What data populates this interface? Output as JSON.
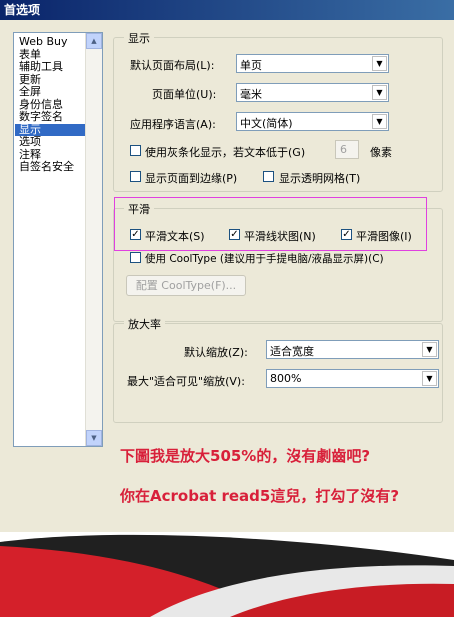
{
  "window": {
    "title": "首选项"
  },
  "sidebar": {
    "items": [
      {
        "label": "Web Buy"
      },
      {
        "label": "表单"
      },
      {
        "label": "辅助工具"
      },
      {
        "label": "更新"
      },
      {
        "label": "全屏"
      },
      {
        "label": "身份信息"
      },
      {
        "label": "数字签名"
      },
      {
        "label": "显示"
      },
      {
        "label": "选项"
      },
      {
        "label": "注释"
      },
      {
        "label": "自签名安全"
      }
    ],
    "selected_index": 7
  },
  "display_group": {
    "title": "显示",
    "page_layout_label": "默认页面布局(L):",
    "page_layout_value": "单页",
    "page_units_label": "页面单位(U):",
    "page_units_value": "毫米",
    "app_language_label": "应用程序语言(A):",
    "app_language_value": "中文(简体)",
    "greek_text_label": "使用灰条化显示，若文本低于(G)",
    "greek_text_value": "6",
    "greek_text_unit": "像素",
    "show_page_edges_label": "显示页面到边缘(P)",
    "show_grid_label": "显示透明网格(T)"
  },
  "smoothing_group": {
    "title": "平滑",
    "smooth_text_label": "平滑文本(S)",
    "smooth_lineart_label": "平滑线状图(N)",
    "smooth_images_label": "平滑图像(I)",
    "cooltype_label": "使用 CoolType (建议用于手提电脑/液晶显示屏)(C)",
    "configure_button": "配置 CoolType(F)..."
  },
  "zoom_group": {
    "title": "放大率",
    "default_zoom_label": "默认缩放(Z):",
    "default_zoom_value": "适合宽度",
    "max_fit_label": "最大\"适合可见\"缩放(V):",
    "max_fit_value": "800%"
  },
  "annotations": {
    "line1": "下圖我是放大505%的，沒有劇齒吧?",
    "line2": "你在Acrobat read5這兒，打勾了沒有?"
  },
  "colors": {
    "note_red": "#d8203a",
    "highlight_magenta": "#e040e0",
    "dialog_bg": "#ece9d8",
    "selection_blue": "#316ac5"
  }
}
